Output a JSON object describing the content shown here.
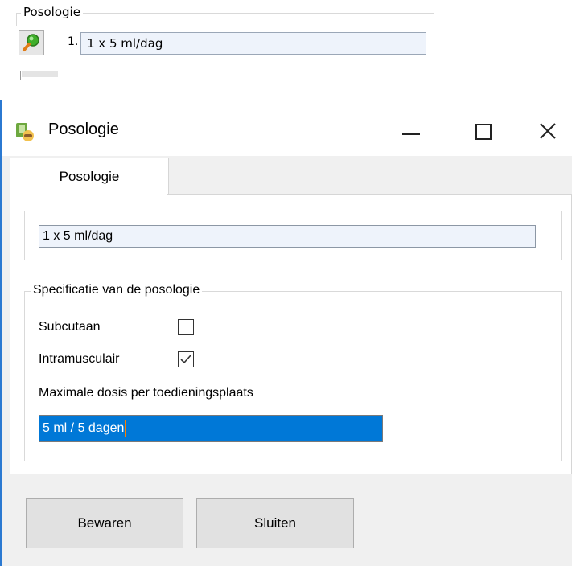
{
  "background": {
    "group_title": "Posologie",
    "row_number": "1.",
    "row_value": "1 x 5 ml/dag"
  },
  "window": {
    "title": "Posologie",
    "accent_color": "#2b79d1"
  },
  "tabs": [
    {
      "label": "Posologie",
      "selected": true
    }
  ],
  "posologie_field": {
    "value": "1 x 5 ml/dag"
  },
  "specification": {
    "group_title": "Specificatie van de posologie",
    "subcutaan": {
      "label": "Subcutaan",
      "checked": false
    },
    "intramusculair": {
      "label": "Intramusculair",
      "checked": true
    },
    "max_label": "Maximale dosis per toedieningsplaats",
    "max_value": "5 ml / 5 dagen"
  },
  "buttons": {
    "save_label": "Bewaren",
    "close_label": "Sluiten"
  },
  "colors": {
    "selection": "#0078d7",
    "field_bg": "#eef3fb"
  }
}
